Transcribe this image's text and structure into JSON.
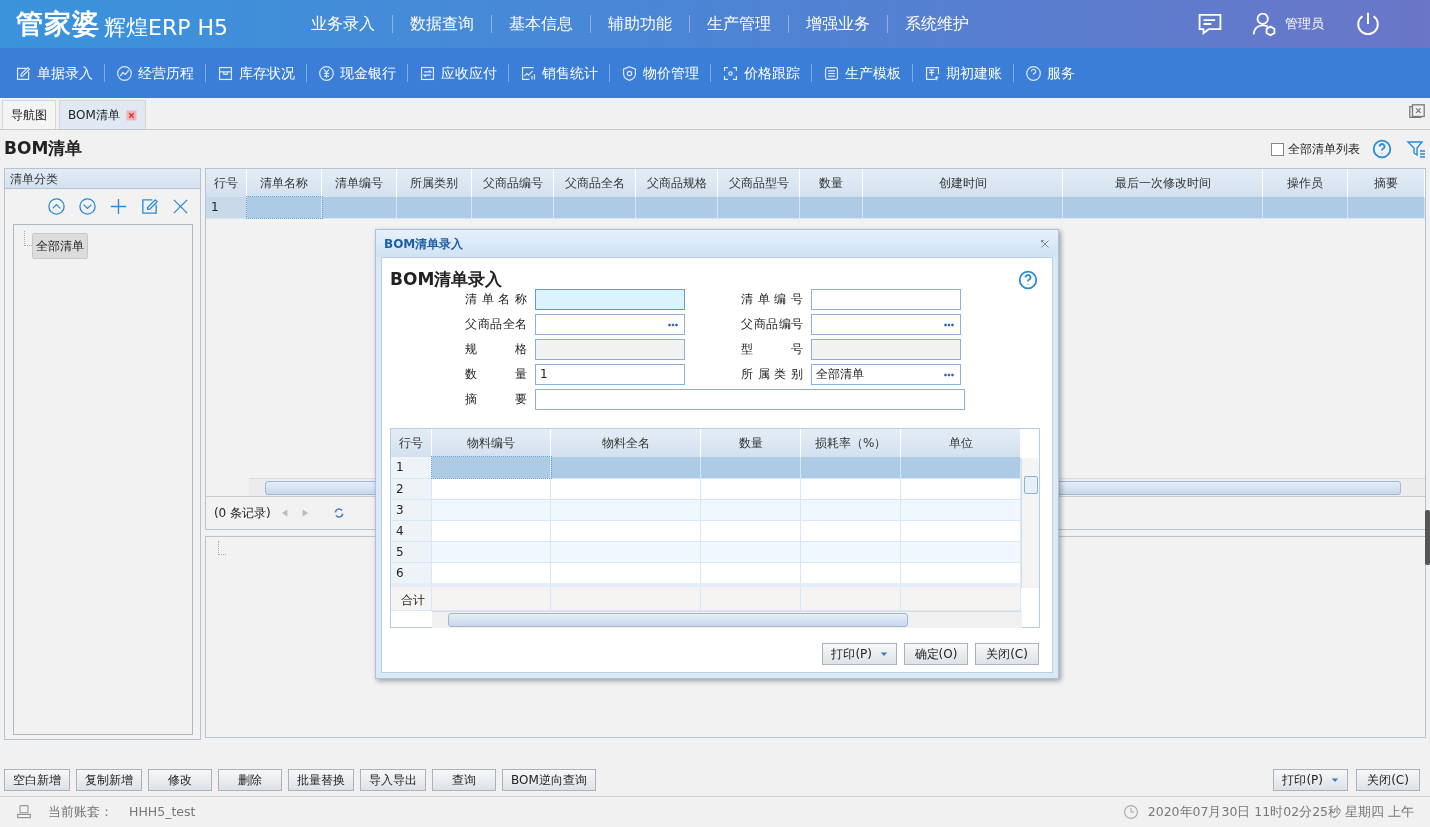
{
  "header": {
    "logo_main": "管家婆",
    "logo_sub": "辉煌ERP H5",
    "menu": [
      "业务录入",
      "数据查询",
      "基本信息",
      "辅助功能",
      "生产管理",
      "增强业务",
      "系统维护"
    ],
    "user": "管理员"
  },
  "toolbar": [
    "单据录入",
    "经营历程",
    "库存状况",
    "现金银行",
    "应收应付",
    "销售统计",
    "物价管理",
    "价格跟踪",
    "生产模板",
    "期初建账",
    "服务"
  ],
  "tabs": [
    {
      "label": "导航图",
      "selected": false,
      "closable": false
    },
    {
      "label": "BOM清单",
      "selected": true,
      "closable": true
    }
  ],
  "page_title": "BOM清单",
  "show_all": {
    "label": "全部清单列表",
    "checked": false
  },
  "category_panel": {
    "title": "清单分类",
    "tree": [
      {
        "label": "全部清单",
        "selected": true
      }
    ]
  },
  "main_table": {
    "columns": [
      "行号",
      "清单名称",
      "清单编号",
      "所属类别",
      "父商品编号",
      "父商品全名",
      "父商品规格",
      "父商品型号",
      "数量",
      "创建时间",
      "最后一次修改时间",
      "操作员",
      "摘要"
    ],
    "rows": [
      {
        "number": "1",
        "selected": true
      }
    ]
  },
  "pager": {
    "text": "(0 条记录)"
  },
  "dialog": {
    "title": "BOM清单录入",
    "heading": "BOM清单录入",
    "fields": [
      {
        "label": "清单名称",
        "kind": "text",
        "focused": true
      },
      {
        "label": "清单编号",
        "kind": "text",
        "focused": false
      },
      {
        "label": "父商品全名",
        "kind": "lookup",
        "focused": false
      },
      {
        "label": "父商品编号",
        "kind": "lookup",
        "focused": false
      },
      {
        "label": "规格",
        "kind": "readonly",
        "focused": false
      },
      {
        "label": "型号",
        "kind": "readonly",
        "focused": false
      },
      {
        "label": "数量",
        "kind": "text",
        "value": "1",
        "focused": false
      },
      {
        "label": "所属类别",
        "kind": "lookup",
        "value": "全部清单",
        "focused": false
      },
      {
        "label": "摘要",
        "kind": "wide",
        "focused": false
      }
    ],
    "grid": {
      "columns": [
        "行号",
        "物料编号",
        "物料全名",
        "数量",
        "损耗率（%）",
        "单位"
      ],
      "rows": [
        {
          "number": "1",
          "selected": true
        },
        {
          "number": "2",
          "selected": false
        },
        {
          "number": "3",
          "selected": false
        },
        {
          "number": "4",
          "selected": false
        },
        {
          "number": "5",
          "selected": false
        },
        {
          "number": "6",
          "selected": false
        }
      ],
      "footer_label": "合计"
    },
    "buttons": [
      {
        "label": "打印(P)",
        "dropdown": true
      },
      {
        "label": "确定(O)",
        "dropdown": false
      },
      {
        "label": "关闭(C)",
        "dropdown": false
      }
    ]
  },
  "bottom_buttons": [
    "空白新增",
    "复制新增",
    "修改",
    "删除",
    "批量替换",
    "导入导出",
    "查询",
    "BOM逆向查询"
  ],
  "bottom_right_buttons": [
    {
      "label": "打印(P)",
      "dropdown": true
    },
    {
      "label": "关闭(C)",
      "dropdown": false
    }
  ],
  "status_bar": {
    "account_label": "当前账套：",
    "account": "HHH5_test",
    "datetime": "2020年07月30日 11时02分25秒 星期四 上午"
  }
}
